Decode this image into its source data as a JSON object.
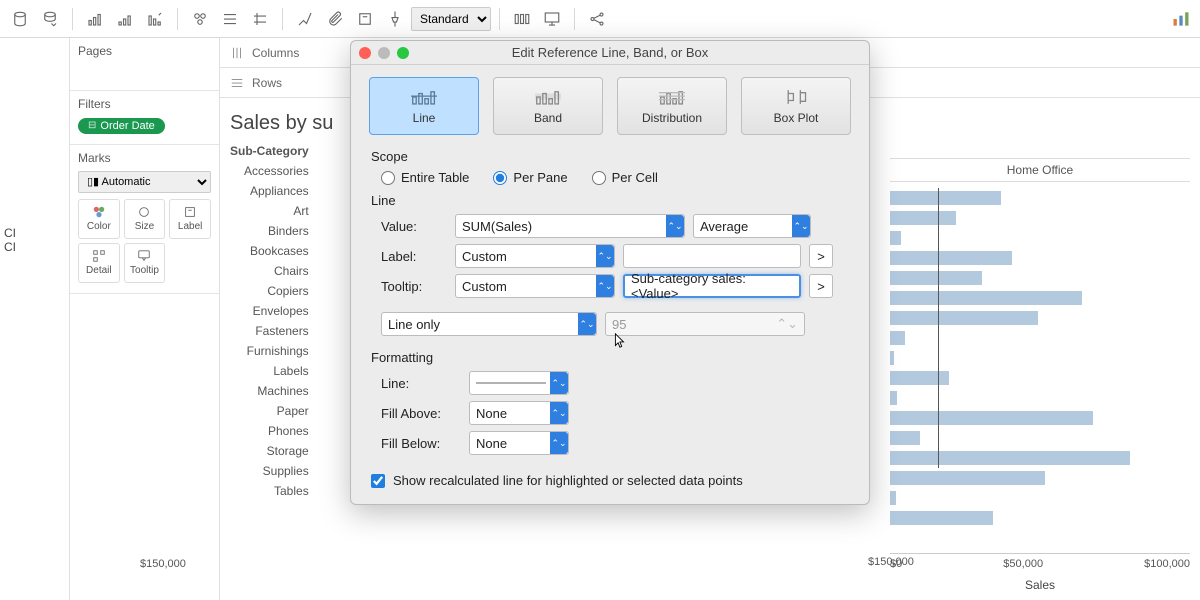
{
  "toolbar": {
    "fit": "Standard"
  },
  "shelves": {
    "columns": "Columns",
    "rows": "Rows"
  },
  "pages_label": "Pages",
  "filters": {
    "label": "Filters",
    "pill": "Order Date"
  },
  "marks": {
    "label": "Marks",
    "type": "Automatic",
    "cells": [
      "Color",
      "Size",
      "Label",
      "Detail",
      "Tooltip"
    ]
  },
  "left": {
    "ci1": "CI",
    "ci2": "CI"
  },
  "viz": {
    "title": "Sales by su",
    "header": "Sub-Category",
    "rows": [
      "Accessories",
      "Appliances",
      "Art",
      "Binders",
      "Bookcases",
      "Chairs",
      "Copiers",
      "Envelopes",
      "Fasteners",
      "Furnishings",
      "Labels",
      "Machines",
      "Paper",
      "Phones",
      "Storage",
      "Supplies",
      "Tables"
    ],
    "col_header": "Home Office",
    "axis_left": "$150,000",
    "axis_ticks": [
      "$0",
      "$50,000",
      "$100,000"
    ],
    "axis_label": "Sales"
  },
  "modal": {
    "title": "Edit Reference Line, Band, or Box",
    "tabs": [
      "Line",
      "Band",
      "Distribution",
      "Box Plot"
    ],
    "scope": {
      "label": "Scope",
      "options": [
        "Entire Table",
        "Per Pane",
        "Per Cell"
      ],
      "selected": "Per Pane"
    },
    "line_section": "Line",
    "value": {
      "label": "Value:",
      "field": "SUM(Sales)",
      "agg": "Average"
    },
    "label_row": {
      "label": "Label:",
      "sel": "Custom",
      "text": ""
    },
    "tooltip_row": {
      "label": "Tooltip:",
      "sel": "Custom",
      "text": "Sub-category sales:<Value>"
    },
    "display": {
      "sel": "Line only",
      "conf": "95"
    },
    "formatting": {
      "label": "Formatting",
      "line": "Line:",
      "fill_above": {
        "label": "Fill Above:",
        "val": "None"
      },
      "fill_below": {
        "label": "Fill Below:",
        "val": "None"
      }
    },
    "recalc": "Show recalculated line for highlighted or selected data points"
  },
  "chart_data": {
    "type": "bar",
    "title": "Sales by Sub-Category — Home Office segment",
    "xlabel": "Sales",
    "ylabel": "Sub-Category",
    "xlim": [
      0,
      120000
    ],
    "reference_line": {
      "value": 25000,
      "aggregation": "Average",
      "field": "SUM(Sales)"
    },
    "categories": [
      "Accessories",
      "Appliances",
      "Art",
      "Binders",
      "Bookcases",
      "Chairs",
      "Copiers",
      "Envelopes",
      "Fasteners",
      "Furnishings",
      "Labels",
      "Machines",
      "Paper",
      "Phones",
      "Storage",
      "Supplies",
      "Tables"
    ],
    "values": [
      30000,
      18000,
      3000,
      33000,
      25000,
      52000,
      40000,
      4000,
      1000,
      16000,
      2000,
      55000,
      8000,
      65000,
      42000,
      1500,
      28000
    ]
  }
}
